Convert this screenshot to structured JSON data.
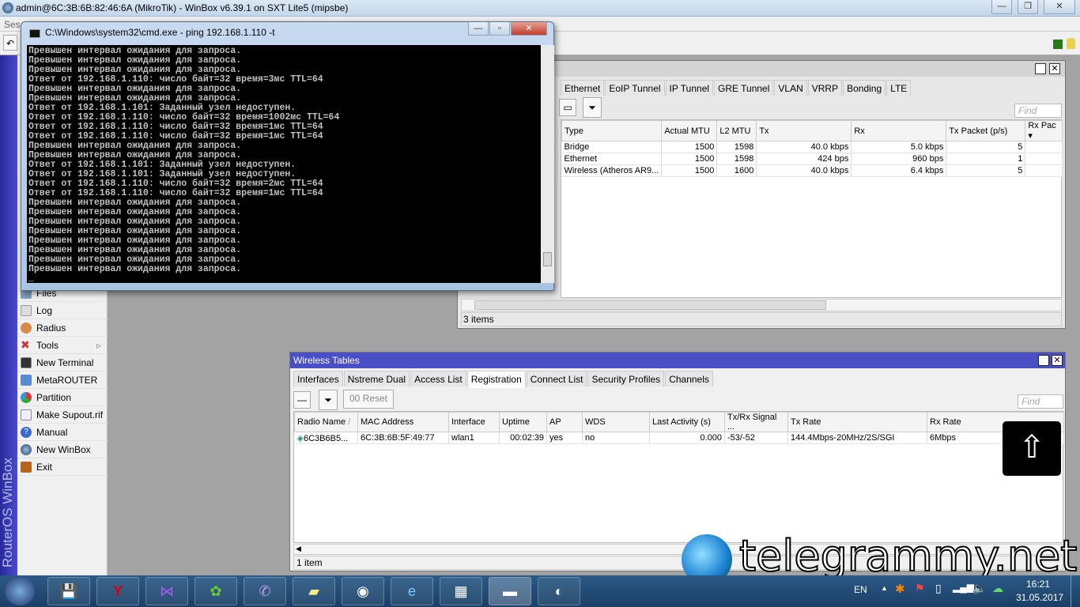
{
  "winbox": {
    "title": "admin@6C:3B:6B:82:46:6A (MikroTik) - WinBox v6.39.1 on SXT Lite5 (mipsbe)",
    "menu_partial": "Ses",
    "brand": "RouterOS WinBox",
    "menu": [
      "Files",
      "Log",
      "Radius",
      "Tools",
      "New Terminal",
      "MetaROUTER",
      "Partition",
      "Make Supout.rif",
      "Manual",
      "New WinBox",
      "Exit"
    ]
  },
  "cmd": {
    "title": "C:\\Windows\\system32\\cmd.exe - ping  192.168.1.110 -t",
    "lines": [
      "Превышен интервал ожидания для запроса.",
      "Превышен интервал ожидания для запроса.",
      "Превышен интервал ожидания для запроса.",
      "Ответ от 192.168.1.110: число байт=32 время=3мс TTL=64",
      "Превышен интервал ожидания для запроса.",
      "Превышен интервал ожидания для запроса.",
      "Ответ от 192.168.1.101: Заданный узел недоступен.",
      "Ответ от 192.168.1.110: число байт=32 время=1002мс TTL=64",
      "Ответ от 192.168.1.110: число байт=32 время=1мс TTL=64",
      "Ответ от 192.168.1.110: число байт=32 время=1мс TTL=64",
      "Превышен интервал ожидания для запроса.",
      "Превышен интервал ожидания для запроса.",
      "Ответ от 192.168.1.101: Заданный узел недоступен.",
      "Ответ от 192.168.1.101: Заданный узел недоступен.",
      "Ответ от 192.168.1.110: число байт=32 время=2мс TTL=64",
      "Ответ от 192.168.1.110: число байт=32 время=1мс TTL=64",
      "Превышен интервал ожидания для запроса.",
      "Превышен интервал ожидания для запроса.",
      "Превышен интервал ожидания для запроса.",
      "Превышен интервал ожидания для запроса.",
      "Превышен интервал ожидания для запроса.",
      "Превышен интервал ожидания для запроса.",
      "Превышен интервал ожидания для запроса.",
      "Превышен интервал ожидания для запроса.",
      "_"
    ]
  },
  "interfaces": {
    "tabs": [
      "Ethernet",
      "EoIP Tunnel",
      "IP Tunnel",
      "GRE Tunnel",
      "VLAN",
      "VRRP",
      "Bonding",
      "LTE"
    ],
    "find": "Find",
    "columns": [
      "Type",
      "Actual MTU",
      "L2 MTU",
      "Tx",
      "Rx",
      "Tx Packet (p/s)",
      "Rx Pac"
    ],
    "rows": [
      [
        "Bridge",
        "1500",
        "1598",
        "40.0 kbps",
        "5.0 kbps",
        "5",
        ""
      ],
      [
        "Ethernet",
        "1500",
        "1598",
        "424 bps",
        "960 bps",
        "1",
        ""
      ],
      [
        "Wireless (Atheros AR9...",
        "1500",
        "1600",
        "40.0 kbps",
        "6.4 kbps",
        "5",
        ""
      ]
    ],
    "status": "3 items"
  },
  "wireless": {
    "title": "Wireless Tables",
    "tabs": [
      "Interfaces",
      "Nstreme Dual",
      "Access List",
      "Registration",
      "Connect List",
      "Security Profiles",
      "Channels"
    ],
    "active_tab": "Registration",
    "reset": "00 Reset",
    "find": "Find",
    "columns": [
      "Radio Name",
      "MAC Address",
      "Interface",
      "Uptime",
      "AP",
      "WDS",
      "Last Activity (s)",
      "Tx/Rx Signal ...",
      "Tx Rate",
      "Rx Rate"
    ],
    "rows": [
      [
        "6C3B6B5...",
        "6C:3B:6B:5F:49:77",
        "wlan1",
        "00:02:39",
        "yes",
        "no",
        "0.000",
        "-53/-52",
        "144.4Mbps-20MHz/2S/SGI",
        "6Mbps"
      ]
    ],
    "status": "1 item"
  },
  "watermark": "telegrammy.net",
  "taskbar": {
    "lang": "EN",
    "time": "16:21",
    "date": "31.05.2017"
  }
}
